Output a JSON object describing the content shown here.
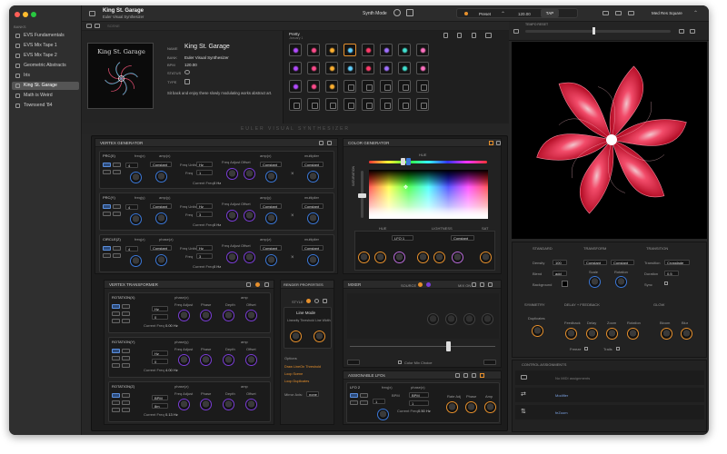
{
  "sidebar": {
    "section": "BANKS",
    "items": [
      {
        "label": "EVS Fundamentals"
      },
      {
        "label": "EVS Mix Tape 1"
      },
      {
        "label": "EVS Mix Tape 2"
      },
      {
        "label": "Geometric Abstracts"
      },
      {
        "label": "Iris"
      },
      {
        "label": "King St. Garage"
      },
      {
        "label": "Math is Weird"
      },
      {
        "label": "Townsend '84"
      }
    ]
  },
  "titlebar": {
    "title": "King St. Garage",
    "subtitle": "Euler Visual Synthesizer",
    "mode": "Synth Mode",
    "preset": "Preset",
    "bpm": "120.00",
    "tap": "TAP",
    "output": "Med Res Square"
  },
  "subbar": {
    "label": "SCENE"
  },
  "timeline": {
    "label": "TEMPO RESET"
  },
  "patch": {
    "tab": "Pretty",
    "tab_sub": "January 1",
    "name_label": "NAME",
    "name": "King St. Garage",
    "bank_label": "BANK",
    "bank": "Euler Visual Synthesizer",
    "bpm_label": "BPM",
    "bpm": "120.00",
    "status_label": "STATUS",
    "type_label": "TYPE",
    "description": "Sit back and enjoy these slowly modulating works abstract art.",
    "thumb_title": "King St. Garage"
  },
  "banner": "EULER VISUAL SYNTHESIZER",
  "vertex": {
    "title": "VERTEX GENERATOR",
    "rows": [
      {
        "name": "PRC(X)",
        "c1": "freq(x)",
        "c2": "amp(x)",
        "c3": "amp(x)",
        "c4": "multiplier",
        "mode": "Constant",
        "units": "Hz",
        "fval": "1",
        "cf": "Current Freq",
        "cfv": "0 Hz",
        "wave": "4"
      },
      {
        "name": "PRC(Y)",
        "c1": "freq(y)",
        "c2": "amp(y)",
        "c3": "amp(y)",
        "c4": "multiplier",
        "mode": "Constant",
        "units": "Hz",
        "fval": "3",
        "cf": "Current Freq",
        "cfv": "0 Hz",
        "wave": "4"
      },
      {
        "name": "CIRCLE(Z)",
        "c1": "freq(z)",
        "c2": "phase(z)",
        "c3": "amp(z)",
        "c4": "multiplier",
        "mode": "Constant",
        "units": "Hz",
        "fval": "3",
        "cf": "Current Freq",
        "cfv": "0 Hz",
        "wave": "4"
      }
    ],
    "freq_adj": "Freq Adjust",
    "offset": "Offset",
    "freq_units": "Freq Units",
    "freq": "Freq"
  },
  "transformer": {
    "title": "VERTEX TRANSFORMER",
    "rows": [
      {
        "name": "ROTATION(X)",
        "c1": "phase(x)",
        "c2": "amp",
        "units": "Hz",
        "fval": "0",
        "cfv": "0.00 Hz"
      },
      {
        "name": "ROTATION(Y)",
        "c1": "phase(y)",
        "c2": "amp",
        "units": "Hz",
        "fval": "0",
        "cfv": "4.00 Hz"
      },
      {
        "name": "ROTATION(Z)",
        "c1": "phase(z)",
        "c2": "amp",
        "units": "BPM",
        "fval": "8m",
        "cfv": "0.13 Hz"
      }
    ],
    "freq_adj": "Freq Adjust",
    "phase": "Phase",
    "depth": "Depth",
    "offset": "Offset",
    "cf": "Current Freq"
  },
  "render": {
    "title": "RENDER PROPERTIES",
    "style": "STYLE",
    "mode_label": "Line Mode",
    "k1": "Linearity Threshold",
    "k2": "Line Width",
    "options": "Options",
    "opt1": "Draw LineOn Threshold",
    "opt2": "Loop Scene",
    "opt3": "Loop Duplicates",
    "mirror": "Mirror Axis:",
    "mirror_val": "none"
  },
  "color": {
    "title": "COLOR GENERATOR",
    "hue": "HUE",
    "lightness": "LIGHTNESS",
    "hue2": "HUE",
    "sat": "SAT",
    "lfo": "LFO 1",
    "mode": "Constant",
    "saturation_label": "SATURATION"
  },
  "mixer": {
    "title": "MIXER",
    "source": "SOURCE",
    "mix": "MIX ON",
    "color_mix": "Color Mix Choice"
  },
  "lfos": {
    "title": "ASSIGNABLE LFOs",
    "name": "LFO 2",
    "c1": "freq(x)",
    "c2": "phase(x)",
    "units": "BPM",
    "fval": "1",
    "cf": "Current Freq",
    "cfv": "0.50 Hz",
    "rate": "Rate Adj",
    "phase": "Phase",
    "amp": "Amp"
  },
  "right": {
    "standard": "STANDARD",
    "density": "Density",
    "density_v": "100",
    "blend": "Blend",
    "blend_v": "add",
    "background": "Background",
    "transform": "TRANSFORM",
    "t_mode": "Constant",
    "scale": "Scale",
    "rotation": "Rotation",
    "transition": "TRANSITION",
    "tr_label": "Transition",
    "tr_v": "Crossfade",
    "duration": "Duration",
    "duration_v": "0.5",
    "sync": "Sync",
    "symmetry": "SYMMETRY",
    "duplicates": "Duplicates",
    "delay": "DELAY + FEEDBACK",
    "feedback": "Feedback",
    "delay_k": "Delay",
    "zoom": "Zoom",
    "rot": "Rotation",
    "freeze": "Freeze",
    "trails": "Trails",
    "glow": "GLOW",
    "bloom": "Bloom",
    "blur": "Blur",
    "control": "CONTROL ASSIGNMENTS",
    "c1": "No MIDI assignments",
    "c2": "Modifier",
    "c3": "feZoom"
  }
}
